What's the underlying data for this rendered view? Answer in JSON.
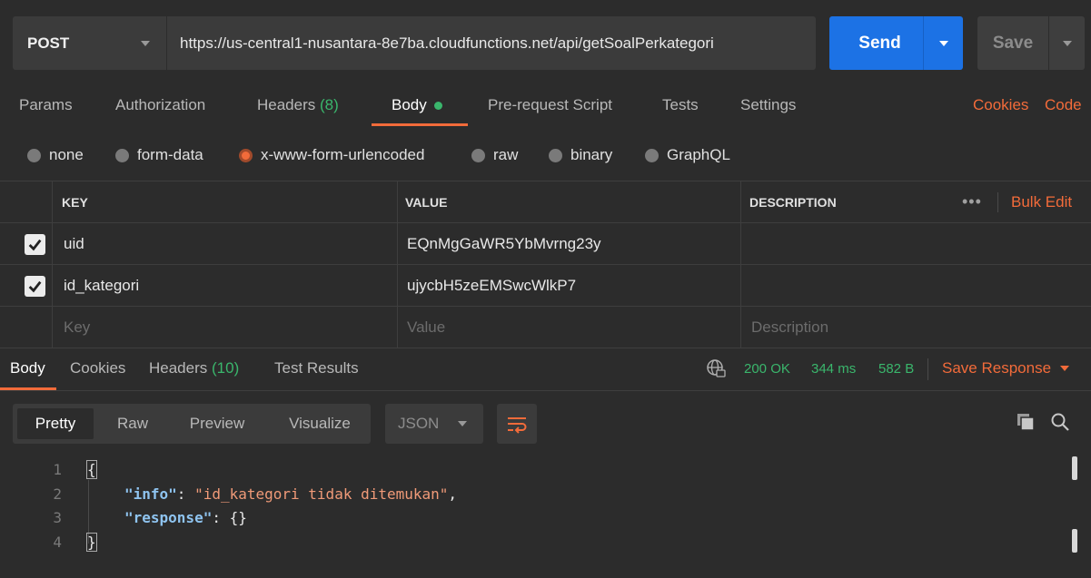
{
  "request": {
    "method": "POST",
    "url": "https://us-central1-nusantara-8e7ba.cloudfunctions.net/api/getSoalPerkategori",
    "send_label": "Send",
    "save_label": "Save"
  },
  "request_tabs": [
    {
      "label": "Params"
    },
    {
      "label": "Authorization"
    },
    {
      "label": "Headers",
      "count": "(8)"
    },
    {
      "label": "Body",
      "active": true
    },
    {
      "label": "Pre-request Script"
    },
    {
      "label": "Tests"
    },
    {
      "label": "Settings"
    }
  ],
  "links": {
    "cookies": "Cookies",
    "code": "Code"
  },
  "body_modes": [
    {
      "label": "none",
      "selected": false
    },
    {
      "label": "form-data",
      "selected": false
    },
    {
      "label": "x-www-form-urlencoded",
      "selected": true
    },
    {
      "label": "raw",
      "selected": false
    },
    {
      "label": "binary",
      "selected": false
    },
    {
      "label": "GraphQL",
      "selected": false
    }
  ],
  "params_table": {
    "headers": {
      "key": "KEY",
      "value": "VALUE",
      "description": "DESCRIPTION"
    },
    "more": "•••",
    "bulk_edit": "Bulk Edit",
    "rows": [
      {
        "checked": true,
        "key": "uid",
        "value": "EQnMgGaWR5YbMvrng23y",
        "description": ""
      },
      {
        "checked": true,
        "key": "id_kategori",
        "value": "ujycbH5zeEMSwcWlkP7",
        "description": ""
      }
    ],
    "placeholders": {
      "key": "Key",
      "value": "Value",
      "description": "Description"
    }
  },
  "response_tabs": [
    {
      "label": "Body",
      "active": true
    },
    {
      "label": "Cookies"
    },
    {
      "label": "Headers",
      "count": "(10)"
    },
    {
      "label": "Test Results"
    }
  ],
  "response_status": {
    "status": "200 OK",
    "time": "344 ms",
    "size": "582 B"
  },
  "save_response": "Save Response",
  "view_tabs": [
    {
      "label": "Pretty",
      "active": true
    },
    {
      "label": "Raw"
    },
    {
      "label": "Preview"
    },
    {
      "label": "Visualize"
    }
  ],
  "format": "JSON",
  "code": {
    "line_numbers": [
      "1",
      "2",
      "3",
      "4"
    ],
    "open_brace": "{",
    "close_brace": "}",
    "info_key": "\"info\"",
    "info_value": "\"id_kategori tidak ditemukan\"",
    "response_key": "\"response\"",
    "response_value": "{}"
  },
  "colors": {
    "accent": "#f26b3a",
    "send": "#1c72e5",
    "success": "#3ab66c",
    "background": "#2c2c2c"
  }
}
